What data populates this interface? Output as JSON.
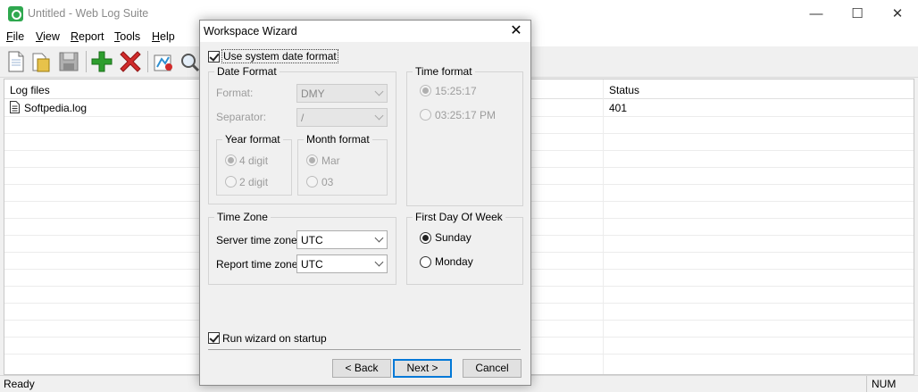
{
  "window": {
    "title": "Untitled - Web Log Suite",
    "controls": {
      "minimize": "—",
      "maximize": "☐",
      "close": "✕"
    }
  },
  "menu": [
    {
      "key": "F",
      "rest": "ile"
    },
    {
      "key": "V",
      "rest": "iew"
    },
    {
      "key": "R",
      "rest": "eport"
    },
    {
      "key": "T",
      "rest": "ools"
    },
    {
      "key": "H",
      "rest": "elp"
    }
  ],
  "toolbar": {
    "icons": [
      "new-file-icon",
      "open-folder-icon",
      "save-disk-icon",
      "add-plus-icon",
      "delete-x-icon",
      "report-generate-icon",
      "find-magnifier-icon"
    ],
    "colors": {
      "add": "#2e9e2e",
      "delete": "#d12b2b"
    }
  },
  "list": {
    "columns": [
      "Log files",
      "Status"
    ],
    "rows": [
      {
        "name": "Softpedia.log",
        "status": "401"
      }
    ]
  },
  "status": {
    "text": "Ready",
    "num": "NUM"
  },
  "dialog": {
    "title": "Workspace Wizard",
    "close": "✕",
    "use_system_date": {
      "label": "Use system date format",
      "checked": true
    },
    "date_format": {
      "title": "Date Format",
      "format_label": "Format:",
      "format_value": "DMY",
      "separator_label": "Separator:",
      "separator_value": "/",
      "year_format": {
        "title": "Year format",
        "opt1": "4 digit",
        "opt2": "2 digit"
      },
      "month_format": {
        "title": "Month format",
        "opt1": "Mar",
        "opt2": "03"
      }
    },
    "time_format": {
      "title": "Time format",
      "opt1": "15:25:17",
      "opt2": "03:25:17 PM"
    },
    "time_zone": {
      "title": "Time Zone",
      "server_label": "Server time zone:",
      "server_value": "UTC",
      "report_label": "Report time zone:",
      "report_value": "UTC"
    },
    "first_day": {
      "title": "First Day Of Week",
      "opt1": "Sunday",
      "opt2": "Monday"
    },
    "run_on_startup": {
      "label": "Run wizard on startup",
      "checked": true
    },
    "buttons": {
      "back": "< Back",
      "next": "Next >",
      "cancel": "Cancel"
    }
  }
}
